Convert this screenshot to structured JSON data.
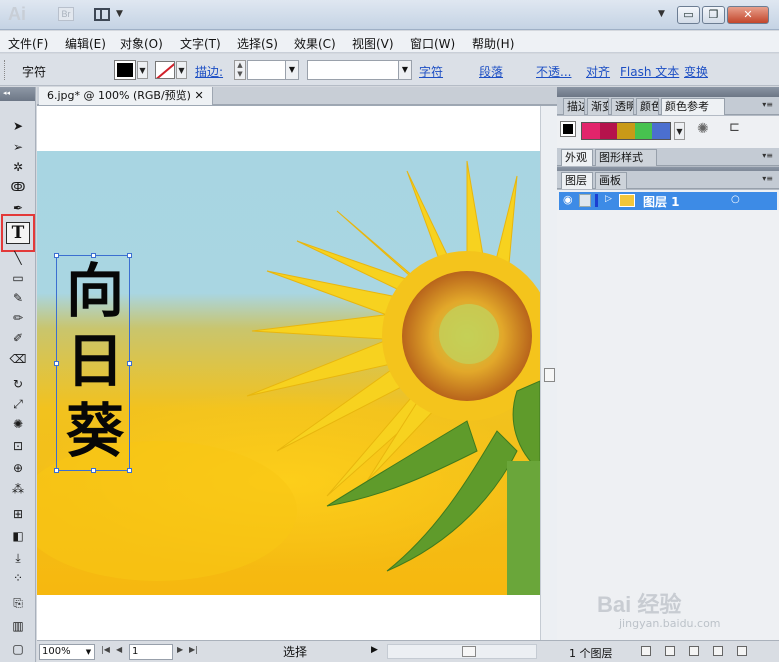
{
  "app": {
    "logo": "Ai",
    "bridge_label": "Br",
    "window_controls": {
      "minimize": "▭",
      "restore": "❐",
      "close": "✕"
    }
  },
  "menu": [
    "文件(F)",
    "编辑(E)",
    "对象(O)",
    "文字(T)",
    "选择(S)",
    "效果(C)",
    "视图(V)",
    "窗口(W)",
    "帮助(H)"
  ],
  "control_bar": {
    "label": "字符",
    "stroke_label": "描边:",
    "links": [
      "字符",
      "段落",
      "不透...",
      "对齐",
      "Flash 文本",
      "变换"
    ]
  },
  "document": {
    "tab_title": "6.jpg* @ 100% (RGB/预览)",
    "text_content": [
      "向",
      "日",
      "葵"
    ]
  },
  "status": {
    "zoom": "100%",
    "page": "1",
    "selection_label": "选择"
  },
  "panels": {
    "group1_tabs": [
      "描边",
      "渐变",
      "透明",
      "颜色",
      "颜色参考"
    ],
    "group2_tabs": [
      "外观",
      "图形样式"
    ],
    "group3_tabs": [
      "图层",
      "画板"
    ],
    "layer_name": "图层 1",
    "layers_count": "1 个图层",
    "harmony_colors": [
      "#e2246b",
      "#b5134c",
      "#c99a17",
      "#47c24f",
      "#4b6fcf"
    ]
  },
  "watermark": {
    "brand": "Bai 经验",
    "url": "jingyan.baidu.com"
  }
}
